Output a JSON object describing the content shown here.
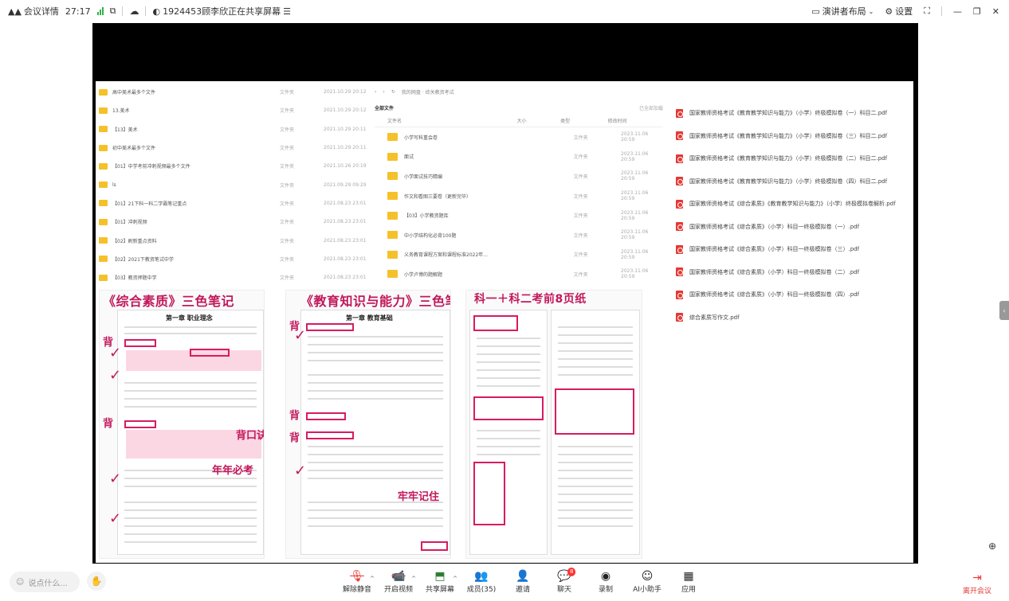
{
  "topbar": {
    "meeting_details": "会议详情",
    "duration": "27:17",
    "sharing_text": "1924453顾李欣正在共享屏幕",
    "layout_label": "演讲者布局",
    "settings_label": "设置"
  },
  "shared": {
    "col1_rows": [
      {
        "name": "高中美术最多个文件",
        "type": "文件夹",
        "date": "2021.10.29 20:12"
      },
      {
        "name": "13.美术",
        "type": "文件夹",
        "date": "2021.10.29 20:12"
      },
      {
        "name": "【13】美术",
        "type": "文件夹",
        "date": "2021.10.29 20:11"
      },
      {
        "name": "初中美术最多个文件",
        "type": "文件夹",
        "date": "2021.10.29 20:11"
      },
      {
        "name": "【01】中学考前冲刺视频最多个文件",
        "type": "文件夹",
        "date": "2021.10.26 20:19"
      },
      {
        "name": "ls",
        "type": "文件夹",
        "date": "2021.09.29 09:29"
      },
      {
        "name": "【01】21下科一科二学霸笔记重点",
        "type": "文件夹",
        "date": "2021.08.23 23:01"
      },
      {
        "name": "【01】冲刺视频",
        "type": "文件夹",
        "date": "2021.08.23 23:01"
      },
      {
        "name": "【02】刷新重点资料",
        "type": "文件夹",
        "date": "2021.08.23 23:01"
      },
      {
        "name": "【02】2021下教资笔试中学",
        "type": "文件夹",
        "date": "2021.08.23 23:01"
      },
      {
        "name": "【03】教资押题中学",
        "type": "文件夹",
        "date": "2021.08.23 23:01"
      }
    ],
    "col2": {
      "breadcrumb": "我的网盘 · 综关教资考试",
      "title": "全部文件",
      "loaded": "已全部加载",
      "headers": [
        "文件名",
        "大小",
        "类型",
        "修改时间"
      ],
      "rows": [
        {
          "name": "小学写科重会卷",
          "type": "文件夹",
          "date": "2023.11.06 20:59"
        },
        {
          "name": "面试",
          "type": "文件夹",
          "date": "2023.11.06 20:59"
        },
        {
          "name": "小学面试技巧精编",
          "type": "文件夹",
          "date": "2023.11.06 20:59"
        },
        {
          "name": "作文和看图三要卷（更新完毕）",
          "type": "文件夹",
          "date": "2023.11.06 20:59"
        },
        {
          "name": "【03】小学教资题库",
          "type": "文件夹",
          "date": "2023.11.06 20:59"
        },
        {
          "name": "中小学结构化必背100题",
          "type": "文件夹",
          "date": "2023.11.06 20:59"
        },
        {
          "name": "义务教育课程方案和课程标准2022年...",
          "type": "文件夹",
          "date": "2023.11.06 20:59"
        },
        {
          "name": "小学卢博的题解题",
          "type": "文件夹",
          "date": "2023.11.06 20:59"
        }
      ]
    },
    "col3_rows": [
      "国家教师资格考试《教育教学知识与能力》（小学）终极模拟卷（一）科目二.pdf",
      "国家教师资格考试《教育教学知识与能力》（小学）终极模拟卷（三）科目二.pdf",
      "国家教师资格考试《教育教学知识与能力》（小学）终极模拟卷（二）科目二.pdf",
      "国家教师资格考试《教育教学知识与能力》（小学）终极模拟卷（四）科目二.pdf",
      "国家教师资格考试《综合素质》《教育教学知识与能力》（小学）终极模拟卷解析.pdf",
      "国家教师资格考试《综合素质》（小学）科目一终极模拟卷（一）.pdf",
      "国家教师资格考试《综合素质》（小学）科目一终极模拟卷（三）.pdf",
      "国家教师资格考试《综合素质》（小学）科目一终极模拟卷（二）.pdf",
      "国家教师资格考试《综合素质》（小学）科目一终极模拟卷（四）.pdf",
      "综合素质写作文.pdf"
    ],
    "notes": [
      {
        "heading_a": "《综合素质》",
        "heading_b": "三色笔记",
        "chapter": "第一章 职业理念",
        "hw1": "背口诀",
        "hw2": "年年必考",
        "mark": "背"
      },
      {
        "heading_a": "《教育知识与能力》",
        "heading_b": "三色笔记",
        "chapter": "第一章 教育基础",
        "hw1": "牢牢记住",
        "mark": "背"
      },
      {
        "heading_a": "科一＋科二",
        "heading_b": "考前8页纸"
      }
    ]
  },
  "bottom": {
    "chat_placeholder": "说点什么...",
    "tools": [
      {
        "label": "解除静音",
        "icon": "mic-off-icon"
      },
      {
        "label": "开启视频",
        "icon": "video-off-icon"
      },
      {
        "label": "共享屏幕",
        "icon": "share-screen-icon"
      },
      {
        "label": "成员(35)",
        "icon": "members-icon"
      },
      {
        "label": "邀请",
        "icon": "invite-icon"
      },
      {
        "label": "聊天",
        "icon": "chat-icon",
        "badge": "8"
      },
      {
        "label": "录制",
        "icon": "record-icon"
      },
      {
        "label": "AI小助手",
        "icon": "ai-assistant-icon"
      },
      {
        "label": "应用",
        "icon": "apps-icon"
      }
    ],
    "leave_label": "离开会议"
  }
}
